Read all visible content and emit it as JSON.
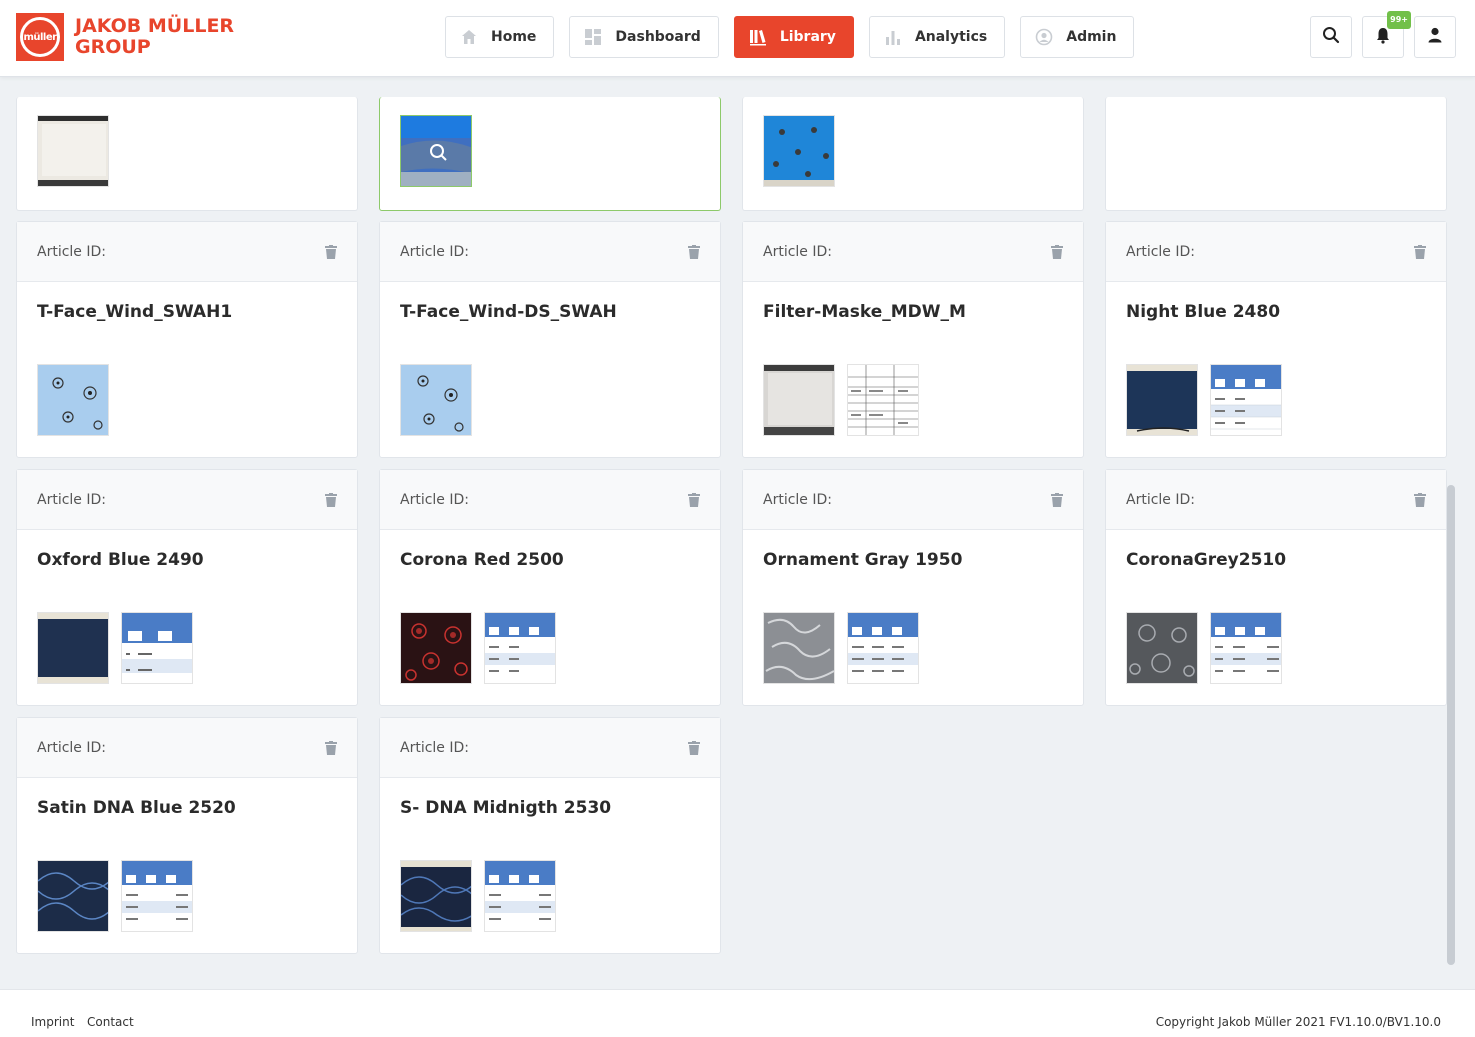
{
  "brand": {
    "line1": "JAKOB MÜLLER",
    "line2": "GROUP",
    "mark": "müller",
    "color": "#e8452c"
  },
  "nav": [
    {
      "label": "Home",
      "icon": "home-icon",
      "active": false
    },
    {
      "label": "Dashboard",
      "icon": "dashboard-icon",
      "active": false
    },
    {
      "label": "Library",
      "icon": "library-icon",
      "active": true
    },
    {
      "label": "Analytics",
      "icon": "analytics-icon",
      "active": false
    },
    {
      "label": "Admin",
      "icon": "admin-icon",
      "active": false
    }
  ],
  "header_actions": {
    "notifications_badge": "99+"
  },
  "cards": [
    {
      "article_label": "Article ID:",
      "title": "T-Face_Wind_SWAH1",
      "thumbs": [
        "light-blue-flower",
        "empty"
      ]
    },
    {
      "article_label": "Article ID:",
      "title": "T-Face_Wind-DS_SWAH",
      "thumbs": [
        "light-blue-flower",
        "empty"
      ]
    },
    {
      "article_label": "Article ID:",
      "title": "Filter-Maske_MDW_M",
      "thumbs": [
        "white-fabric",
        "spec-sheet"
      ]
    },
    {
      "article_label": "Article ID:",
      "title": "Night Blue 2480",
      "thumbs": [
        "dark-blue",
        "blue-table"
      ]
    },
    {
      "article_label": "Article ID:",
      "title": "Oxford Blue 2490",
      "thumbs": [
        "dark-blue",
        "blue-table"
      ]
    },
    {
      "article_label": "Article ID:",
      "title": "Corona Red 2500",
      "thumbs": [
        "red-virus",
        "blue-table"
      ]
    },
    {
      "article_label": "Article ID:",
      "title": "Ornament Gray 1950",
      "thumbs": [
        "gray-ornament",
        "blue-table"
      ]
    },
    {
      "article_label": "Article ID:",
      "title": "CoronaGrey2510",
      "thumbs": [
        "gray-virus",
        "blue-table"
      ]
    },
    {
      "article_label": "Article ID:",
      "title": "Satin DNA Blue 2520",
      "thumbs": [
        "dna-blue",
        "blue-table"
      ]
    },
    {
      "article_label": "Article ID:",
      "title": "S- DNA Midnigth 2530",
      "thumbs": [
        "dna-blue",
        "blue-table"
      ]
    }
  ],
  "footer": {
    "imprint": "Imprint",
    "contact": "Contact",
    "copyright": "Copyright Jakob Müller 2021 FV1.10.0/BV1.10.0"
  }
}
